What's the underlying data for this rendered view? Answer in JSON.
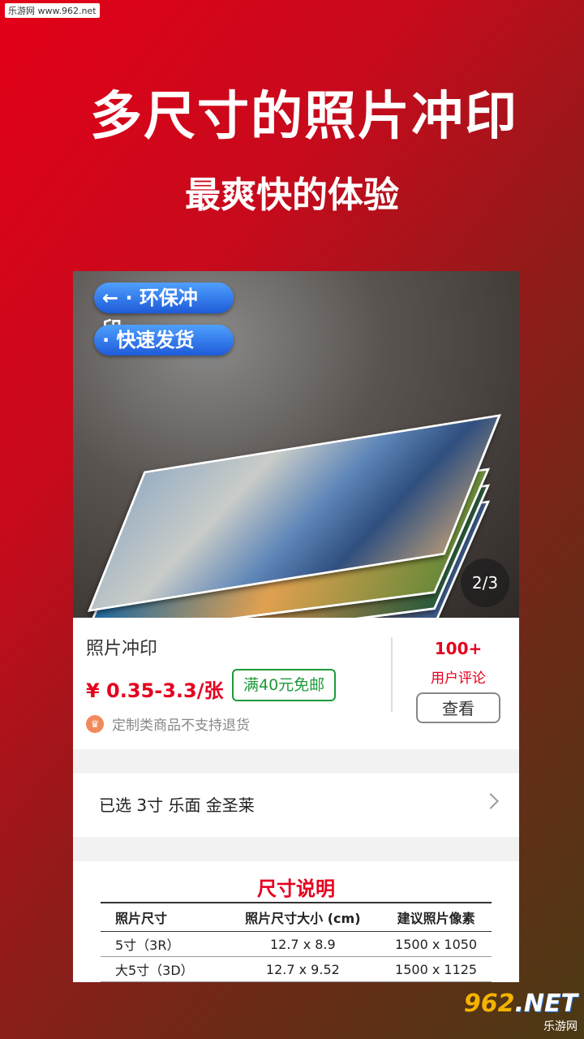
{
  "watermark_top": "乐游网 www.962.net",
  "headline": "多尺寸的照片冲印",
  "subheadline": "最爽快的体验",
  "hero": {
    "tags": [
      "← · 环保冲印",
      "· 快速发货"
    ],
    "counter": "2/3"
  },
  "product": {
    "name": "照片冲印",
    "price": "¥ 0.35-3.3/张",
    "shipping": "满40元免邮",
    "note": "定制类商品不支持退货",
    "reviews_count": "100+",
    "reviews_label": "用户评论",
    "view_button": "查看"
  },
  "selection": "已选 3寸 乐面 金圣莱",
  "size_table": {
    "title": "尺寸说明",
    "headers": [
      "照片尺寸",
      "照片尺寸大小 (cm)",
      "建议照片像素"
    ],
    "rows": [
      [
        "5寸（3R）",
        "12.7 x 8.9",
        "1500 x 1050"
      ],
      [
        "大5寸（3D）",
        "12.7 x 9.52",
        "1500 x 1125"
      ]
    ]
  },
  "watermark_bottom": {
    "big_a": "962",
    "big_b": ".NET",
    "small": "乐游网"
  },
  "colors": {
    "accent": "#e4001e",
    "ship_green": "#1e9a3a",
    "pill_blue": "#1e5bd8"
  }
}
